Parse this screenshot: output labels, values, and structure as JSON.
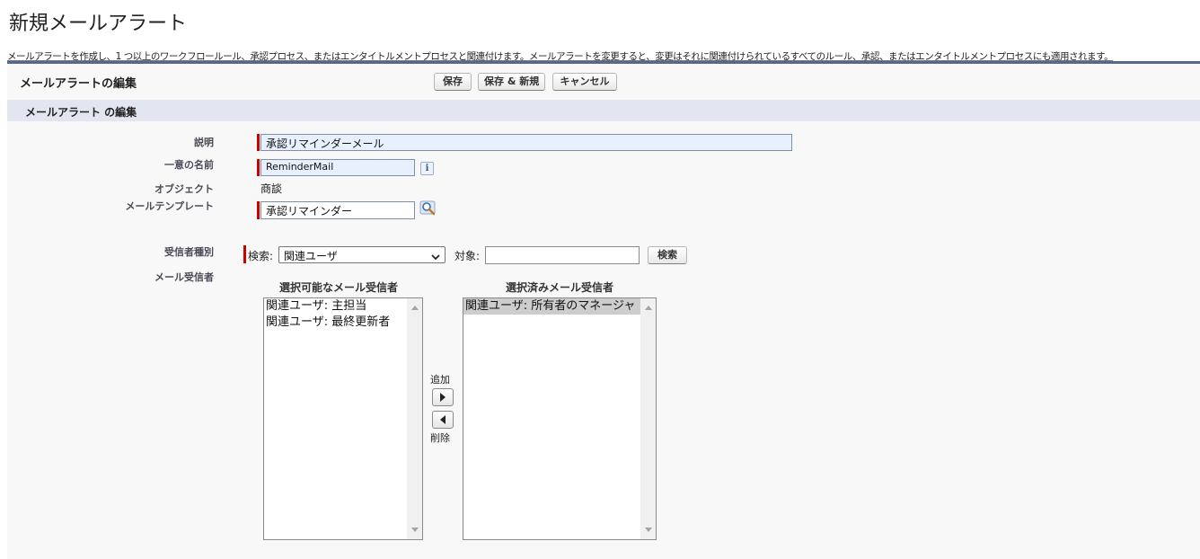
{
  "page": {
    "title": "新規メールアラート",
    "description": "メールアラートを作成し、1 つ以上のワークフロールール、承認プロセス、またはエンタイトルメントプロセスと関連付けます。メールアラートを変更すると、変更はそれに関連付けられているすべてのルール、承認、またはエンタイトルメントプロセスにも適用されます。"
  },
  "panel": {
    "title": "メールアラートの編集",
    "buttons": {
      "save": "保存",
      "save_new": "保存 & 新規",
      "cancel": "キャンセル"
    },
    "section_title": "メールアラート の編集"
  },
  "form": {
    "description_label": "説明",
    "description_value": "承認リマインダーメール",
    "unique_name_label": "一意の名前",
    "unique_name_value": "ReminderMail",
    "object_label": "オブジェクト",
    "object_value": "商談",
    "template_label": "メールテンプレート",
    "template_value": "承認リマインダー",
    "recipient_type_label": "受信者種別",
    "search_label": "検索:",
    "search_select_value": "関連ユーザ",
    "for_label": "対象:",
    "for_value": "",
    "search_button": "検索",
    "recipients_label": "メール受信者"
  },
  "recipients": {
    "available_title": "選択可能なメール受信者",
    "available": [
      "関連ユーザ: 主担当",
      "関連ユーザ: 最終更新者"
    ],
    "selected_title": "選択済みメール受信者",
    "selected": [
      "関連ユーザ: 所有者のマネージャ"
    ],
    "add_label": "追加",
    "remove_label": "削除"
  },
  "icons": {
    "info": "info-icon",
    "lookup": "lookup-magnifier-icon",
    "add_arrow": "arrow-right-icon",
    "remove_arrow": "arrow-left-icon"
  },
  "colors": {
    "required_bar": "#cc0000",
    "panel_border": "#54698d",
    "section_bg": "#e2e6f0"
  }
}
